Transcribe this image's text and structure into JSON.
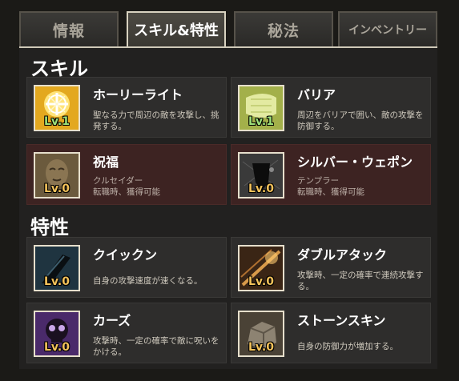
{
  "tabs": [
    {
      "label": "情報",
      "active": false
    },
    {
      "label": "スキル&特性",
      "active": true
    },
    {
      "label": "秘法",
      "active": false
    },
    {
      "label": "インベントリー",
      "active": false
    }
  ],
  "skills_title": "スキル",
  "skills": [
    {
      "name": "ホーリーライト",
      "level": "Lv.1",
      "desc": "聖なる力で周辺の敵を攻撃し、挑発する。",
      "icon": "holy-light-icon"
    },
    {
      "name": "バリア",
      "level": "Lv.1",
      "desc": "周辺をバリアで囲い、敵の攻撃を防御する。",
      "icon": "barrier-icon"
    },
    {
      "name": "祝福",
      "level": "Lv.0",
      "desc": "クルセイダー\n転職時、獲得可能",
      "icon": "blessing-icon"
    },
    {
      "name": "シルバー・ウェポン",
      "level": "Lv.0",
      "desc": "テンプラー\n転職時、獲得可能",
      "icon": "silver-weapon-icon"
    }
  ],
  "traits_title": "特性",
  "traits": [
    {
      "name": "クイックン",
      "level": "Lv.0",
      "desc": "自身の攻撃速度が速くなる。",
      "icon": "quicken-icon"
    },
    {
      "name": "ダブルアタック",
      "level": "Lv.0",
      "desc": "攻撃時、一定の確率で連続攻撃する。",
      "icon": "double-attack-icon"
    },
    {
      "name": "カーズ",
      "level": "Lv.0",
      "desc": "攻撃時、一定の確率で敵に呪いをかける。",
      "icon": "curse-icon"
    },
    {
      "name": "ストーンスキン",
      "level": "Lv.0",
      "desc": "自身の防御力が増加する。",
      "icon": "stone-skin-icon"
    }
  ],
  "colors": {
    "panel": "#222120",
    "locked_card": "#3d2322",
    "level_active": "#9de07a",
    "level_zero": "#f3c25a"
  }
}
